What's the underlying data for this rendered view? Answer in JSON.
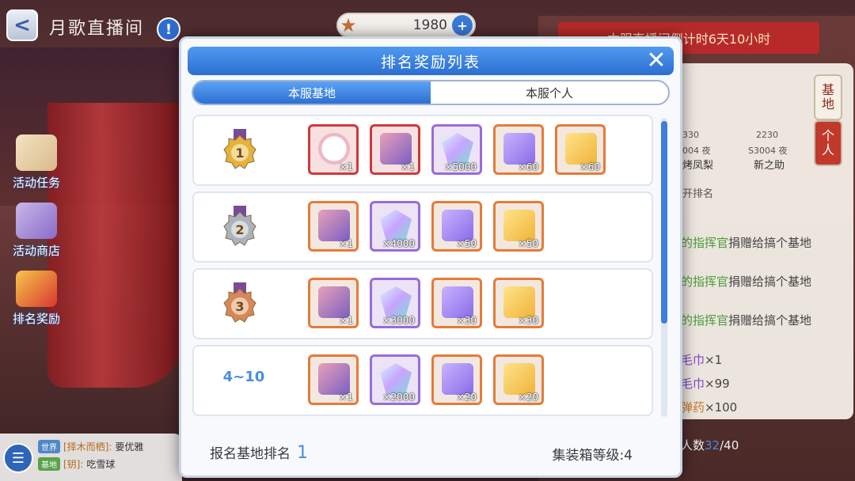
{
  "header": {
    "back_label": "<",
    "title": "月歌直播间",
    "info_label": "!",
    "currency_value": "1980",
    "plus_label": "+",
    "countdown": "本服直播间倒计时6天10小时"
  },
  "left_menu": [
    {
      "label": "活动任务",
      "icon": "task-scroll-icon"
    },
    {
      "label": "活动商店",
      "icon": "shop-icon"
    },
    {
      "label": "排名奖励",
      "icon": "gift-icon"
    }
  ],
  "right_panel": {
    "tabs": [
      "基\n地",
      "个\n人"
    ],
    "ranks": [
      {
        "score": "330",
        "server": "004 夜",
        "name": "烤凤梨"
      },
      {
        "score": "2230",
        "server": "S3004 夜",
        "name": "新之助"
      }
    ],
    "section_label": "开排名",
    "feed": [
      {
        "pre": "的指挥官",
        "post": "捐赠给搞个基地"
      },
      {
        "pre": "的指挥官",
        "post": "捐赠给搞个基地"
      },
      {
        "pre": "的指挥官",
        "post": "捐赠给搞个基地"
      },
      {
        "pre": "毛巾",
        "post": "×1"
      },
      {
        "pre": "毛巾",
        "post": "×99"
      },
      {
        "pre": "弹药",
        "post": "×100"
      }
    ],
    "count_label": "人数",
    "count_current": "32",
    "count_total": "/40"
  },
  "chat": {
    "lines": [
      {
        "tag": "世界",
        "who": "[择木而栖]:",
        "text": "要优雅"
      },
      {
        "tag": "基地",
        "who": "[钥]:",
        "text": "吃雪球"
      }
    ]
  },
  "modal": {
    "title": "排名奖励列表",
    "close_label": "✕",
    "tabs": [
      {
        "label": "本服基地",
        "active": true
      },
      {
        "label": "本服个人",
        "active": false
      }
    ],
    "rows": [
      {
        "rank": "1",
        "medal_color": "#e7b23a",
        "items": [
          {
            "icon": "frame-icon",
            "qty": "×1",
            "rarity": "red"
          },
          {
            "icon": "pack-icon",
            "qty": "×1",
            "rarity": "red"
          },
          {
            "icon": "crystal-icon",
            "qty": "×5000",
            "rarity": "purple"
          },
          {
            "icon": "purple-ticket-icon",
            "qty": "×60",
            "rarity": "orange"
          },
          {
            "icon": "gold-ticket-icon",
            "qty": "×60",
            "rarity": "orange"
          }
        ]
      },
      {
        "rank": "2",
        "medal_color": "#a9b3c2",
        "items": [
          {
            "icon": "pack-icon",
            "qty": "×1",
            "rarity": "orange"
          },
          {
            "icon": "crystal-icon",
            "qty": "×4000",
            "rarity": "purple"
          },
          {
            "icon": "purple-ticket-icon",
            "qty": "×50",
            "rarity": "orange"
          },
          {
            "icon": "gold-ticket-icon",
            "qty": "×50",
            "rarity": "orange"
          }
        ]
      },
      {
        "rank": "3",
        "medal_color": "#d7875a",
        "items": [
          {
            "icon": "pack-icon",
            "qty": "×1",
            "rarity": "orange"
          },
          {
            "icon": "crystal-icon",
            "qty": "×3000",
            "rarity": "purple"
          },
          {
            "icon": "purple-ticket-icon",
            "qty": "×30",
            "rarity": "orange"
          },
          {
            "icon": "gold-ticket-icon",
            "qty": "×30",
            "rarity": "orange"
          }
        ]
      },
      {
        "rank": "4~10",
        "medal_color": "",
        "items": [
          {
            "icon": "pack-icon",
            "qty": "×1",
            "rarity": "orange"
          },
          {
            "icon": "crystal-icon",
            "qty": "×2000",
            "rarity": "purple"
          },
          {
            "icon": "purple-ticket-icon",
            "qty": "×20",
            "rarity": "orange"
          },
          {
            "icon": "gold-ticket-icon",
            "qty": "×20",
            "rarity": "orange"
          }
        ]
      }
    ],
    "footer_label": "报名基地排名",
    "footer_rank": "1",
    "footer_level": "集装箱等级:4"
  },
  "colors": {
    "accent": "#2c6ed0",
    "rank_text": "#4a8de0",
    "countdown_bg": "#b82a2a"
  }
}
